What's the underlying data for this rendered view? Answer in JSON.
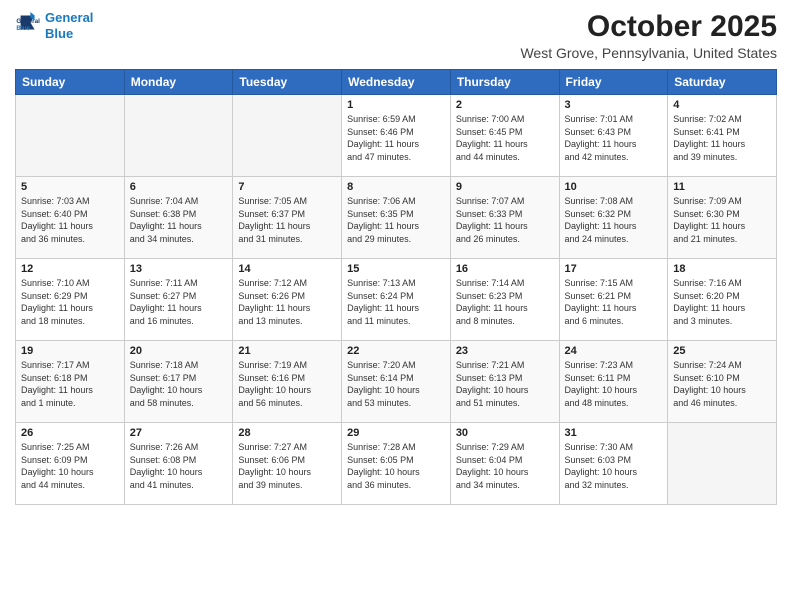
{
  "header": {
    "logo_line1": "General",
    "logo_line2": "Blue",
    "month": "October 2025",
    "location": "West Grove, Pennsylvania, United States"
  },
  "days_of_week": [
    "Sunday",
    "Monday",
    "Tuesday",
    "Wednesday",
    "Thursday",
    "Friday",
    "Saturday"
  ],
  "weeks": [
    [
      {
        "day": "",
        "info": ""
      },
      {
        "day": "",
        "info": ""
      },
      {
        "day": "",
        "info": ""
      },
      {
        "day": "1",
        "info": "Sunrise: 6:59 AM\nSunset: 6:46 PM\nDaylight: 11 hours\nand 47 minutes."
      },
      {
        "day": "2",
        "info": "Sunrise: 7:00 AM\nSunset: 6:45 PM\nDaylight: 11 hours\nand 44 minutes."
      },
      {
        "day": "3",
        "info": "Sunrise: 7:01 AM\nSunset: 6:43 PM\nDaylight: 11 hours\nand 42 minutes."
      },
      {
        "day": "4",
        "info": "Sunrise: 7:02 AM\nSunset: 6:41 PM\nDaylight: 11 hours\nand 39 minutes."
      }
    ],
    [
      {
        "day": "5",
        "info": "Sunrise: 7:03 AM\nSunset: 6:40 PM\nDaylight: 11 hours\nand 36 minutes."
      },
      {
        "day": "6",
        "info": "Sunrise: 7:04 AM\nSunset: 6:38 PM\nDaylight: 11 hours\nand 34 minutes."
      },
      {
        "day": "7",
        "info": "Sunrise: 7:05 AM\nSunset: 6:37 PM\nDaylight: 11 hours\nand 31 minutes."
      },
      {
        "day": "8",
        "info": "Sunrise: 7:06 AM\nSunset: 6:35 PM\nDaylight: 11 hours\nand 29 minutes."
      },
      {
        "day": "9",
        "info": "Sunrise: 7:07 AM\nSunset: 6:33 PM\nDaylight: 11 hours\nand 26 minutes."
      },
      {
        "day": "10",
        "info": "Sunrise: 7:08 AM\nSunset: 6:32 PM\nDaylight: 11 hours\nand 24 minutes."
      },
      {
        "day": "11",
        "info": "Sunrise: 7:09 AM\nSunset: 6:30 PM\nDaylight: 11 hours\nand 21 minutes."
      }
    ],
    [
      {
        "day": "12",
        "info": "Sunrise: 7:10 AM\nSunset: 6:29 PM\nDaylight: 11 hours\nand 18 minutes."
      },
      {
        "day": "13",
        "info": "Sunrise: 7:11 AM\nSunset: 6:27 PM\nDaylight: 11 hours\nand 16 minutes."
      },
      {
        "day": "14",
        "info": "Sunrise: 7:12 AM\nSunset: 6:26 PM\nDaylight: 11 hours\nand 13 minutes."
      },
      {
        "day": "15",
        "info": "Sunrise: 7:13 AM\nSunset: 6:24 PM\nDaylight: 11 hours\nand 11 minutes."
      },
      {
        "day": "16",
        "info": "Sunrise: 7:14 AM\nSunset: 6:23 PM\nDaylight: 11 hours\nand 8 minutes."
      },
      {
        "day": "17",
        "info": "Sunrise: 7:15 AM\nSunset: 6:21 PM\nDaylight: 11 hours\nand 6 minutes."
      },
      {
        "day": "18",
        "info": "Sunrise: 7:16 AM\nSunset: 6:20 PM\nDaylight: 11 hours\nand 3 minutes."
      }
    ],
    [
      {
        "day": "19",
        "info": "Sunrise: 7:17 AM\nSunset: 6:18 PM\nDaylight: 11 hours\nand 1 minute."
      },
      {
        "day": "20",
        "info": "Sunrise: 7:18 AM\nSunset: 6:17 PM\nDaylight: 10 hours\nand 58 minutes."
      },
      {
        "day": "21",
        "info": "Sunrise: 7:19 AM\nSunset: 6:16 PM\nDaylight: 10 hours\nand 56 minutes."
      },
      {
        "day": "22",
        "info": "Sunrise: 7:20 AM\nSunset: 6:14 PM\nDaylight: 10 hours\nand 53 minutes."
      },
      {
        "day": "23",
        "info": "Sunrise: 7:21 AM\nSunset: 6:13 PM\nDaylight: 10 hours\nand 51 minutes."
      },
      {
        "day": "24",
        "info": "Sunrise: 7:23 AM\nSunset: 6:11 PM\nDaylight: 10 hours\nand 48 minutes."
      },
      {
        "day": "25",
        "info": "Sunrise: 7:24 AM\nSunset: 6:10 PM\nDaylight: 10 hours\nand 46 minutes."
      }
    ],
    [
      {
        "day": "26",
        "info": "Sunrise: 7:25 AM\nSunset: 6:09 PM\nDaylight: 10 hours\nand 44 minutes."
      },
      {
        "day": "27",
        "info": "Sunrise: 7:26 AM\nSunset: 6:08 PM\nDaylight: 10 hours\nand 41 minutes."
      },
      {
        "day": "28",
        "info": "Sunrise: 7:27 AM\nSunset: 6:06 PM\nDaylight: 10 hours\nand 39 minutes."
      },
      {
        "day": "29",
        "info": "Sunrise: 7:28 AM\nSunset: 6:05 PM\nDaylight: 10 hours\nand 36 minutes."
      },
      {
        "day": "30",
        "info": "Sunrise: 7:29 AM\nSunset: 6:04 PM\nDaylight: 10 hours\nand 34 minutes."
      },
      {
        "day": "31",
        "info": "Sunrise: 7:30 AM\nSunset: 6:03 PM\nDaylight: 10 hours\nand 32 minutes."
      },
      {
        "day": "",
        "info": ""
      }
    ]
  ]
}
